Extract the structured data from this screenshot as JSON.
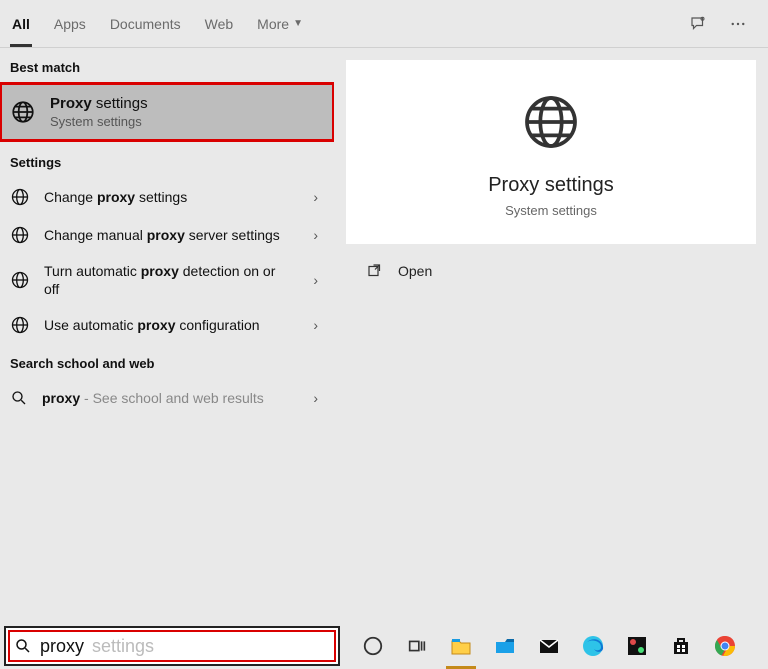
{
  "tabs": {
    "all": "All",
    "apps": "Apps",
    "documents": "Documents",
    "web": "Web",
    "more": "More"
  },
  "sections": {
    "best": "Best match",
    "settings": "Settings",
    "searchweb": "Search school and web"
  },
  "best": {
    "title_pre": "Proxy",
    "title_post": " settings",
    "subtitle": "System settings"
  },
  "settings_rows": [
    {
      "pre": "Change ",
      "b": "proxy",
      "post": " settings"
    },
    {
      "pre": "Change manual ",
      "b": "proxy",
      "post": " server settings"
    },
    {
      "pre": "Turn automatic ",
      "b": "proxy",
      "post": " detection on or off"
    },
    {
      "pre": "Use automatic ",
      "b": "proxy",
      "post": " configuration"
    }
  ],
  "web_row": {
    "b": "proxy",
    "post": " - See school and web results"
  },
  "preview": {
    "title": "Proxy settings",
    "subtitle": "System settings",
    "open": "Open"
  },
  "search": {
    "typed": "proxy",
    "hint": " settings"
  }
}
